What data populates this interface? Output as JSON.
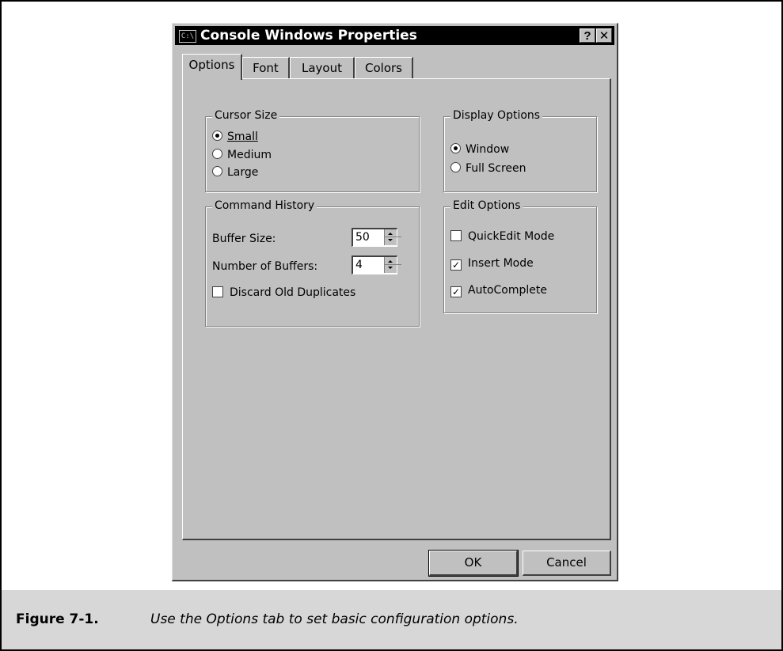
{
  "dialog": {
    "title": "Console Windows Properties",
    "app_icon_text": "C:\\",
    "help_button": "?",
    "close_button": "✕"
  },
  "tabs": [
    {
      "label": "Options",
      "active": true
    },
    {
      "label": "Font",
      "active": false
    },
    {
      "label": "Layout",
      "active": false
    },
    {
      "label": "Colors",
      "active": false
    }
  ],
  "cursor_size": {
    "legend": "Cursor Size",
    "options": [
      {
        "label": "Small",
        "selected": true
      },
      {
        "label": "Medium",
        "selected": false
      },
      {
        "label": "Large",
        "selected": false
      }
    ]
  },
  "display_options": {
    "legend": "Display Options",
    "options": [
      {
        "label": "Window",
        "selected": true
      },
      {
        "label": "Full Screen",
        "selected": false
      }
    ]
  },
  "command_history": {
    "legend": "Command History",
    "buffer_size_label": "Buffer Size:",
    "buffer_size_value": "50",
    "num_buffers_label": "Number of Buffers:",
    "num_buffers_value": "4",
    "discard_label": "Discard Old Duplicates",
    "discard_checked": false
  },
  "edit_options": {
    "legend": "Edit Options",
    "items": [
      {
        "label": "QuickEdit Mode",
        "checked": false
      },
      {
        "label": "Insert Mode",
        "checked": true
      },
      {
        "label": "AutoComplete",
        "checked": true
      }
    ]
  },
  "buttons": {
    "ok": "OK",
    "cancel": "Cancel"
  },
  "caption": {
    "figure": "Figure 7-1.",
    "text": "Use the Options tab to set basic configuration options."
  }
}
